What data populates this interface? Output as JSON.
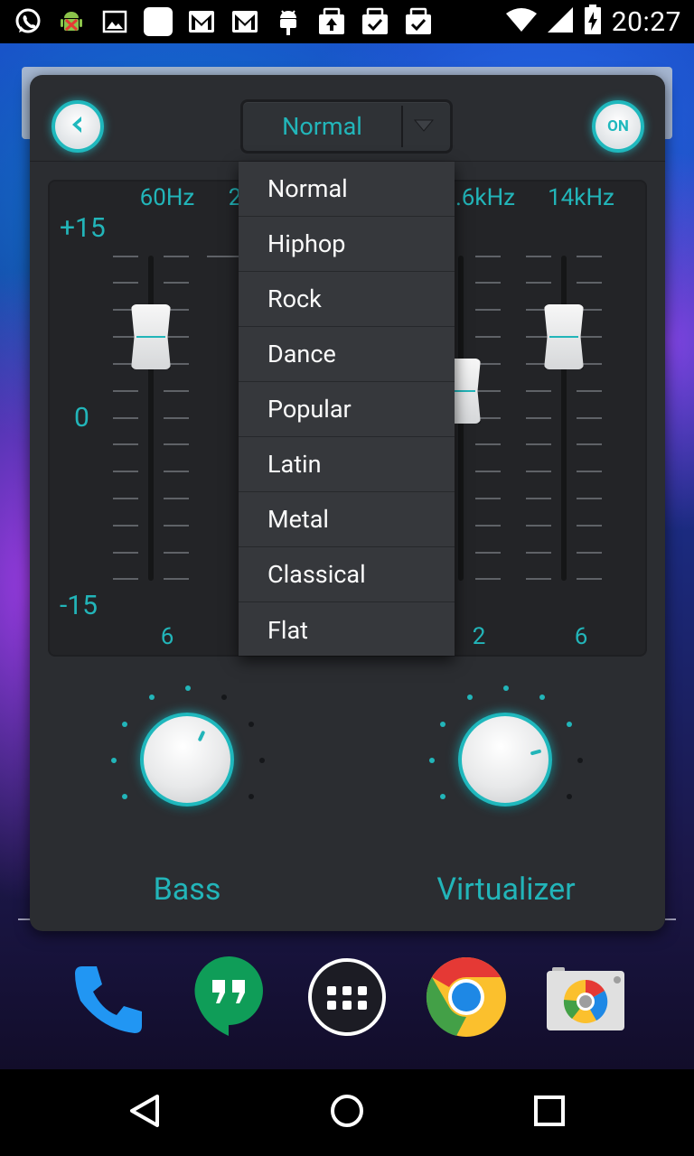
{
  "status_bar": {
    "time": "20:27",
    "notification_icons": [
      "whatsapp-icon",
      "android-bug-icon",
      "image-icon",
      "blank-app-icon",
      "gmail-icon",
      "gmail-icon",
      "android-icon",
      "upload-icon",
      "checklist-icon",
      "checklist-icon"
    ],
    "system_icons": [
      "wifi-icon",
      "signal-icon",
      "battery-charging-icon"
    ]
  },
  "equalizer": {
    "back_icon": "chevron-left-icon",
    "power_label": "ON",
    "preset": {
      "selected": "Normal",
      "options": [
        "Normal",
        "Hiphop",
        "Rock",
        "Dance",
        "Popular",
        "Latin",
        "Metal",
        "Classical",
        "Flat"
      ]
    },
    "db_scale": {
      "max": "+15",
      "mid": "0",
      "min": "-15"
    },
    "bands": [
      {
        "freq": "60Hz",
        "value": "6",
        "level": 6
      },
      {
        "freq": "2",
        "value": "",
        "level": 0
      },
      {
        "freq": ".6kHz",
        "value": "2",
        "level": 2
      },
      {
        "freq": "14kHz",
        "value": "6",
        "level": 6
      }
    ],
    "bass": {
      "label": "Bass"
    },
    "virtualizer": {
      "label": "Virtualizer"
    },
    "accent_color": "#22b5b9",
    "panel_color": "#2b2d31"
  },
  "dock": [
    "phone-icon",
    "hangouts-icon",
    "app-drawer-icon",
    "chrome-icon",
    "camera-icon"
  ],
  "nav_bar": [
    "back-icon",
    "home-icon",
    "recents-icon"
  ]
}
